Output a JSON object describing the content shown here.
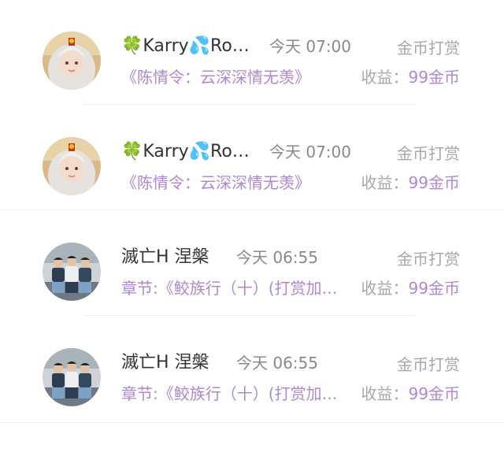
{
  "items": [
    {
      "name": "🍀Karry💦Ro…",
      "time": "今天 07:00",
      "action": "金币打赏",
      "desc": "《陈情令：云深深情无羡》",
      "earn_label": "收益：",
      "earn_value": "99金币",
      "avatar": "girl-avatar"
    },
    {
      "name": "🍀Karry💦Ro…",
      "time": "今天 07:00",
      "action": "金币打赏",
      "desc": "《陈情令：云深深情无羡》",
      "earn_label": "收益：",
      "earn_value": "99金币",
      "avatar": "girl-avatar"
    },
    {
      "name": "滅亡H 涅槃",
      "time": "今天 06:55",
      "action": "金币打赏",
      "desc": "章节:《鲛族行（十）(打赏加…",
      "earn_label": "收益：",
      "earn_value": "99金币",
      "avatar": "group-avatar"
    },
    {
      "name": "滅亡H 涅槃",
      "time": "今天 06:55",
      "action": "金币打赏",
      "desc": "章节:《鲛族行（十）(打赏加…",
      "earn_label": "收益：",
      "earn_value": "99金币",
      "avatar": "group-avatar"
    }
  ],
  "colors": {
    "accent": "#b087d2",
    "muted": "#a8a8a8",
    "name": "#333333"
  }
}
